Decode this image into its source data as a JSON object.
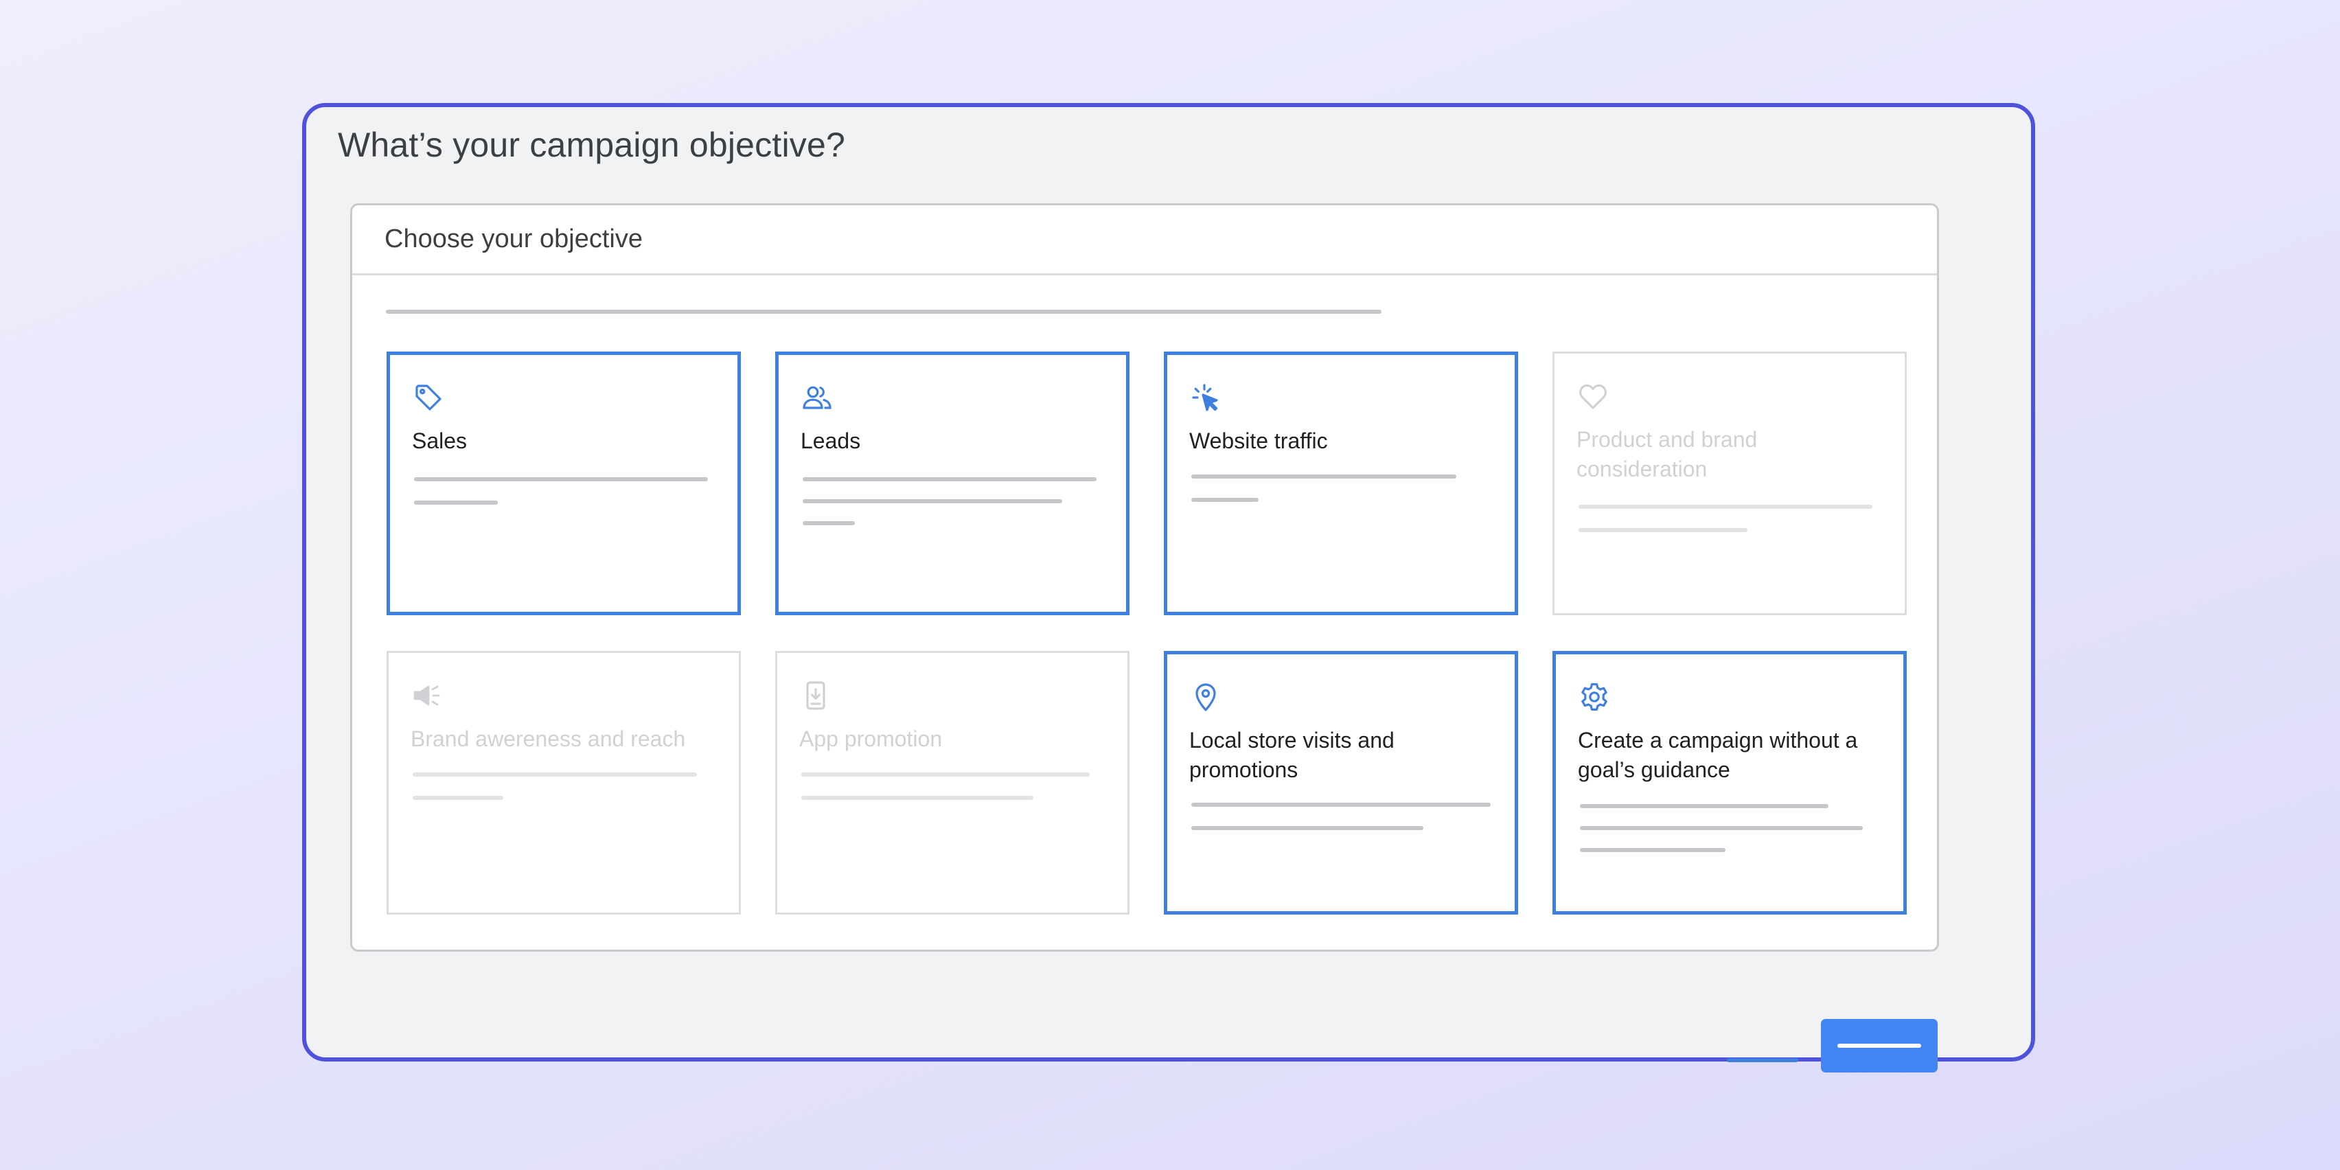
{
  "dialog": {
    "title": "What’s your campaign objective?"
  },
  "panel": {
    "title": "Choose your objective"
  },
  "objectives": [
    {
      "label": "Sales",
      "icon": "tag-icon",
      "state": "selected"
    },
    {
      "label": "Leads",
      "icon": "people-icon",
      "state": "selected"
    },
    {
      "label": "Website traffic",
      "icon": "cursor-click-icon",
      "state": "selected"
    },
    {
      "label": "Product and brand consideration",
      "icon": "heart-icon",
      "state": "disabled"
    },
    {
      "label": "Brand awereness and reach",
      "icon": "megaphone-icon",
      "state": "disabled"
    },
    {
      "label": "App promotion",
      "icon": "phone-download-icon",
      "state": "disabled"
    },
    {
      "label": "Local store visits and promotions",
      "icon": "location-pin-icon",
      "state": "selected"
    },
    {
      "label": "Create a campaign without a goal’s guidance",
      "icon": "gear-icon",
      "state": "selected"
    }
  ],
  "colors": {
    "accent": "#4285f4",
    "card_border_selected": "#3f7fe0",
    "card_border_disabled": "#dcdde0",
    "frame_border": "#4f52da",
    "frame_background": "#f1f2f4",
    "placeholder_line": "#c4c6c9",
    "disabled_text": "#d0d1d4"
  }
}
